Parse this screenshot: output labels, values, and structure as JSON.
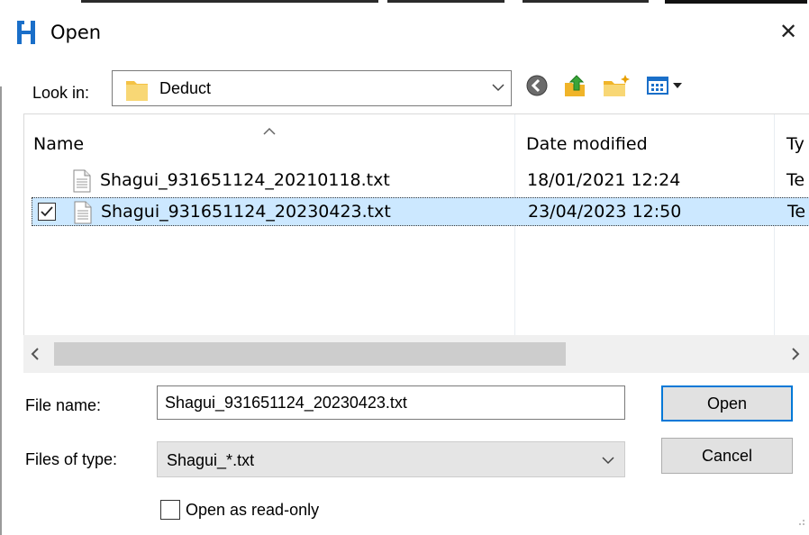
{
  "window": {
    "title": "Open",
    "app_icon": "app-h-logo-icon",
    "close_glyph": "✕"
  },
  "toolbar": {
    "lookin_label": "Look in:",
    "lookin_value": "Deduct",
    "icons": [
      "back-icon",
      "up-folder-icon",
      "new-folder-icon",
      "view-menu-icon"
    ]
  },
  "list": {
    "columns": {
      "name": "Name",
      "date": "Date modified",
      "type": "Ty"
    },
    "rows": [
      {
        "name": "Shagui_931651124_20210118.txt",
        "date": "18/01/2021 12:24",
        "type": "Te",
        "selected": false
      },
      {
        "name": "Shagui_931651124_20230423.txt",
        "date": "23/04/2023 12:50",
        "type": "Te",
        "selected": true
      }
    ],
    "scroll_left_glyph": "<",
    "scroll_right_glyph": ">"
  },
  "form": {
    "filename_label": "File name:",
    "filename_value": "Shagui_931651124_20230423.txt",
    "filetype_label": "Files of type:",
    "filetype_value": "Shagui_*.txt",
    "open_button": "Open",
    "cancel_button": "Cancel",
    "readonly_label": "Open as read-only"
  },
  "colors": {
    "selection": "#cce8ff",
    "accent": "#0078d7",
    "app_icon": "#1a6fc9",
    "folder": "#f8d775"
  }
}
